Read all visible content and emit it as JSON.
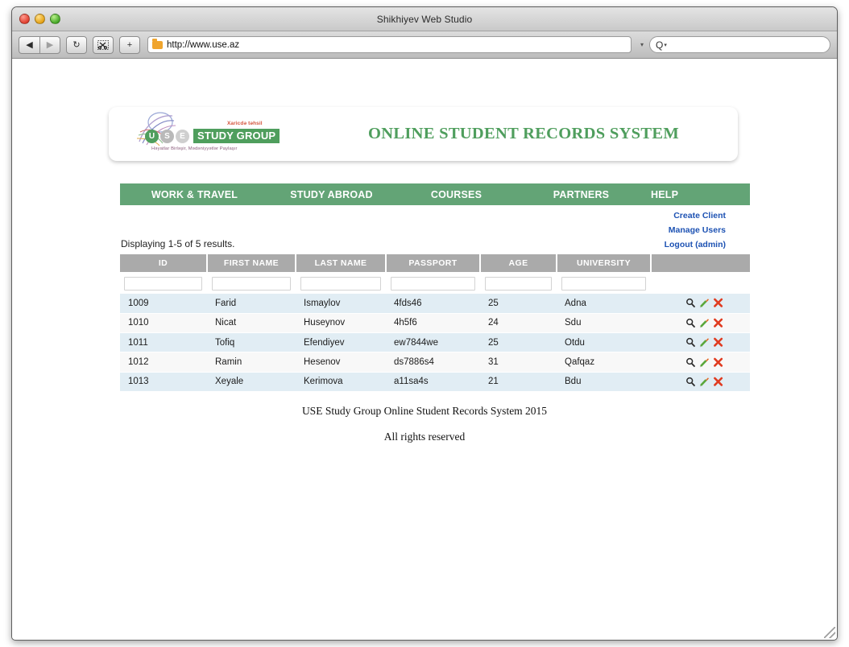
{
  "browser": {
    "window_title": "Shikhiyev Web Studio",
    "traffic_lights": [
      "close",
      "minimize",
      "zoom"
    ],
    "toolbar": {
      "back_label": "◀",
      "forward_label": "▶",
      "reload_label": "↻",
      "snippet_label": "✂",
      "add_label": "+",
      "url_value": "http://www.use.az",
      "url_dropdown_caret": "▾",
      "search_placeholder": "",
      "search_glyph": "Q",
      "search_caret": "▾"
    }
  },
  "site": {
    "title": "ONLINE STUDENT RECORDS SYSTEM",
    "logo": {
      "sub_text": "Xaricdə təhsil",
      "circles": [
        "U",
        "S",
        "E"
      ],
      "box_text": "STUDY GROUP",
      "tagline": "Həyatlar Birləşir, Mədəniyyətlər Paylaşır"
    },
    "accent_green": "#63a476",
    "link_blue": "#1d52b3",
    "header_gray": "#aaaaaa",
    "row_odd": "#e1edf4",
    "row_even": "#f8f8f8"
  },
  "nav": {
    "items": [
      {
        "label": "WORK & TRAVEL"
      },
      {
        "label": "STUDY ABROAD"
      },
      {
        "label": "COURSES"
      },
      {
        "label": "PARTNERS"
      },
      {
        "label": "HELP"
      }
    ]
  },
  "user_links": [
    {
      "label": "Create Client"
    },
    {
      "label": "Manage Users"
    },
    {
      "label": "Logout (admin)"
    }
  ],
  "results": {
    "summary": "Displaying 1-5 of 5 results."
  },
  "table": {
    "columns": [
      "ID",
      "FIRST NAME",
      "LAST NAME",
      "PASSPORT",
      "AGE",
      "UNIVERSITY",
      ""
    ],
    "filters": [
      "",
      "",
      "",
      "",
      "",
      ""
    ],
    "rows": [
      {
        "id": "1009",
        "first_name": "Farid",
        "last_name": "Ismaylov",
        "passport": "4fds46",
        "age": "25",
        "university": "Adna"
      },
      {
        "id": "1010",
        "first_name": "Nicat",
        "last_name": "Huseynov",
        "passport": "4h5f6",
        "age": "24",
        "university": "Sdu"
      },
      {
        "id": "1011",
        "first_name": "Tofiq",
        "last_name": "Efendiyev",
        "passport": "ew7844we",
        "age": "25",
        "university": "Otdu"
      },
      {
        "id": "1012",
        "first_name": "Ramin",
        "last_name": "Hesenov",
        "passport": "ds7886s4",
        "age": "31",
        "university": "Qafqaz"
      },
      {
        "id": "1013",
        "first_name": "Xeyale",
        "last_name": "Kerimova",
        "passport": "a11sa4s",
        "age": "21",
        "university": "Bdu"
      }
    ],
    "row_actions": [
      "view",
      "update",
      "delete"
    ]
  },
  "footer": {
    "line1": "USE Study Group Online Student Records System 2015",
    "line2": "All rights reserved"
  }
}
